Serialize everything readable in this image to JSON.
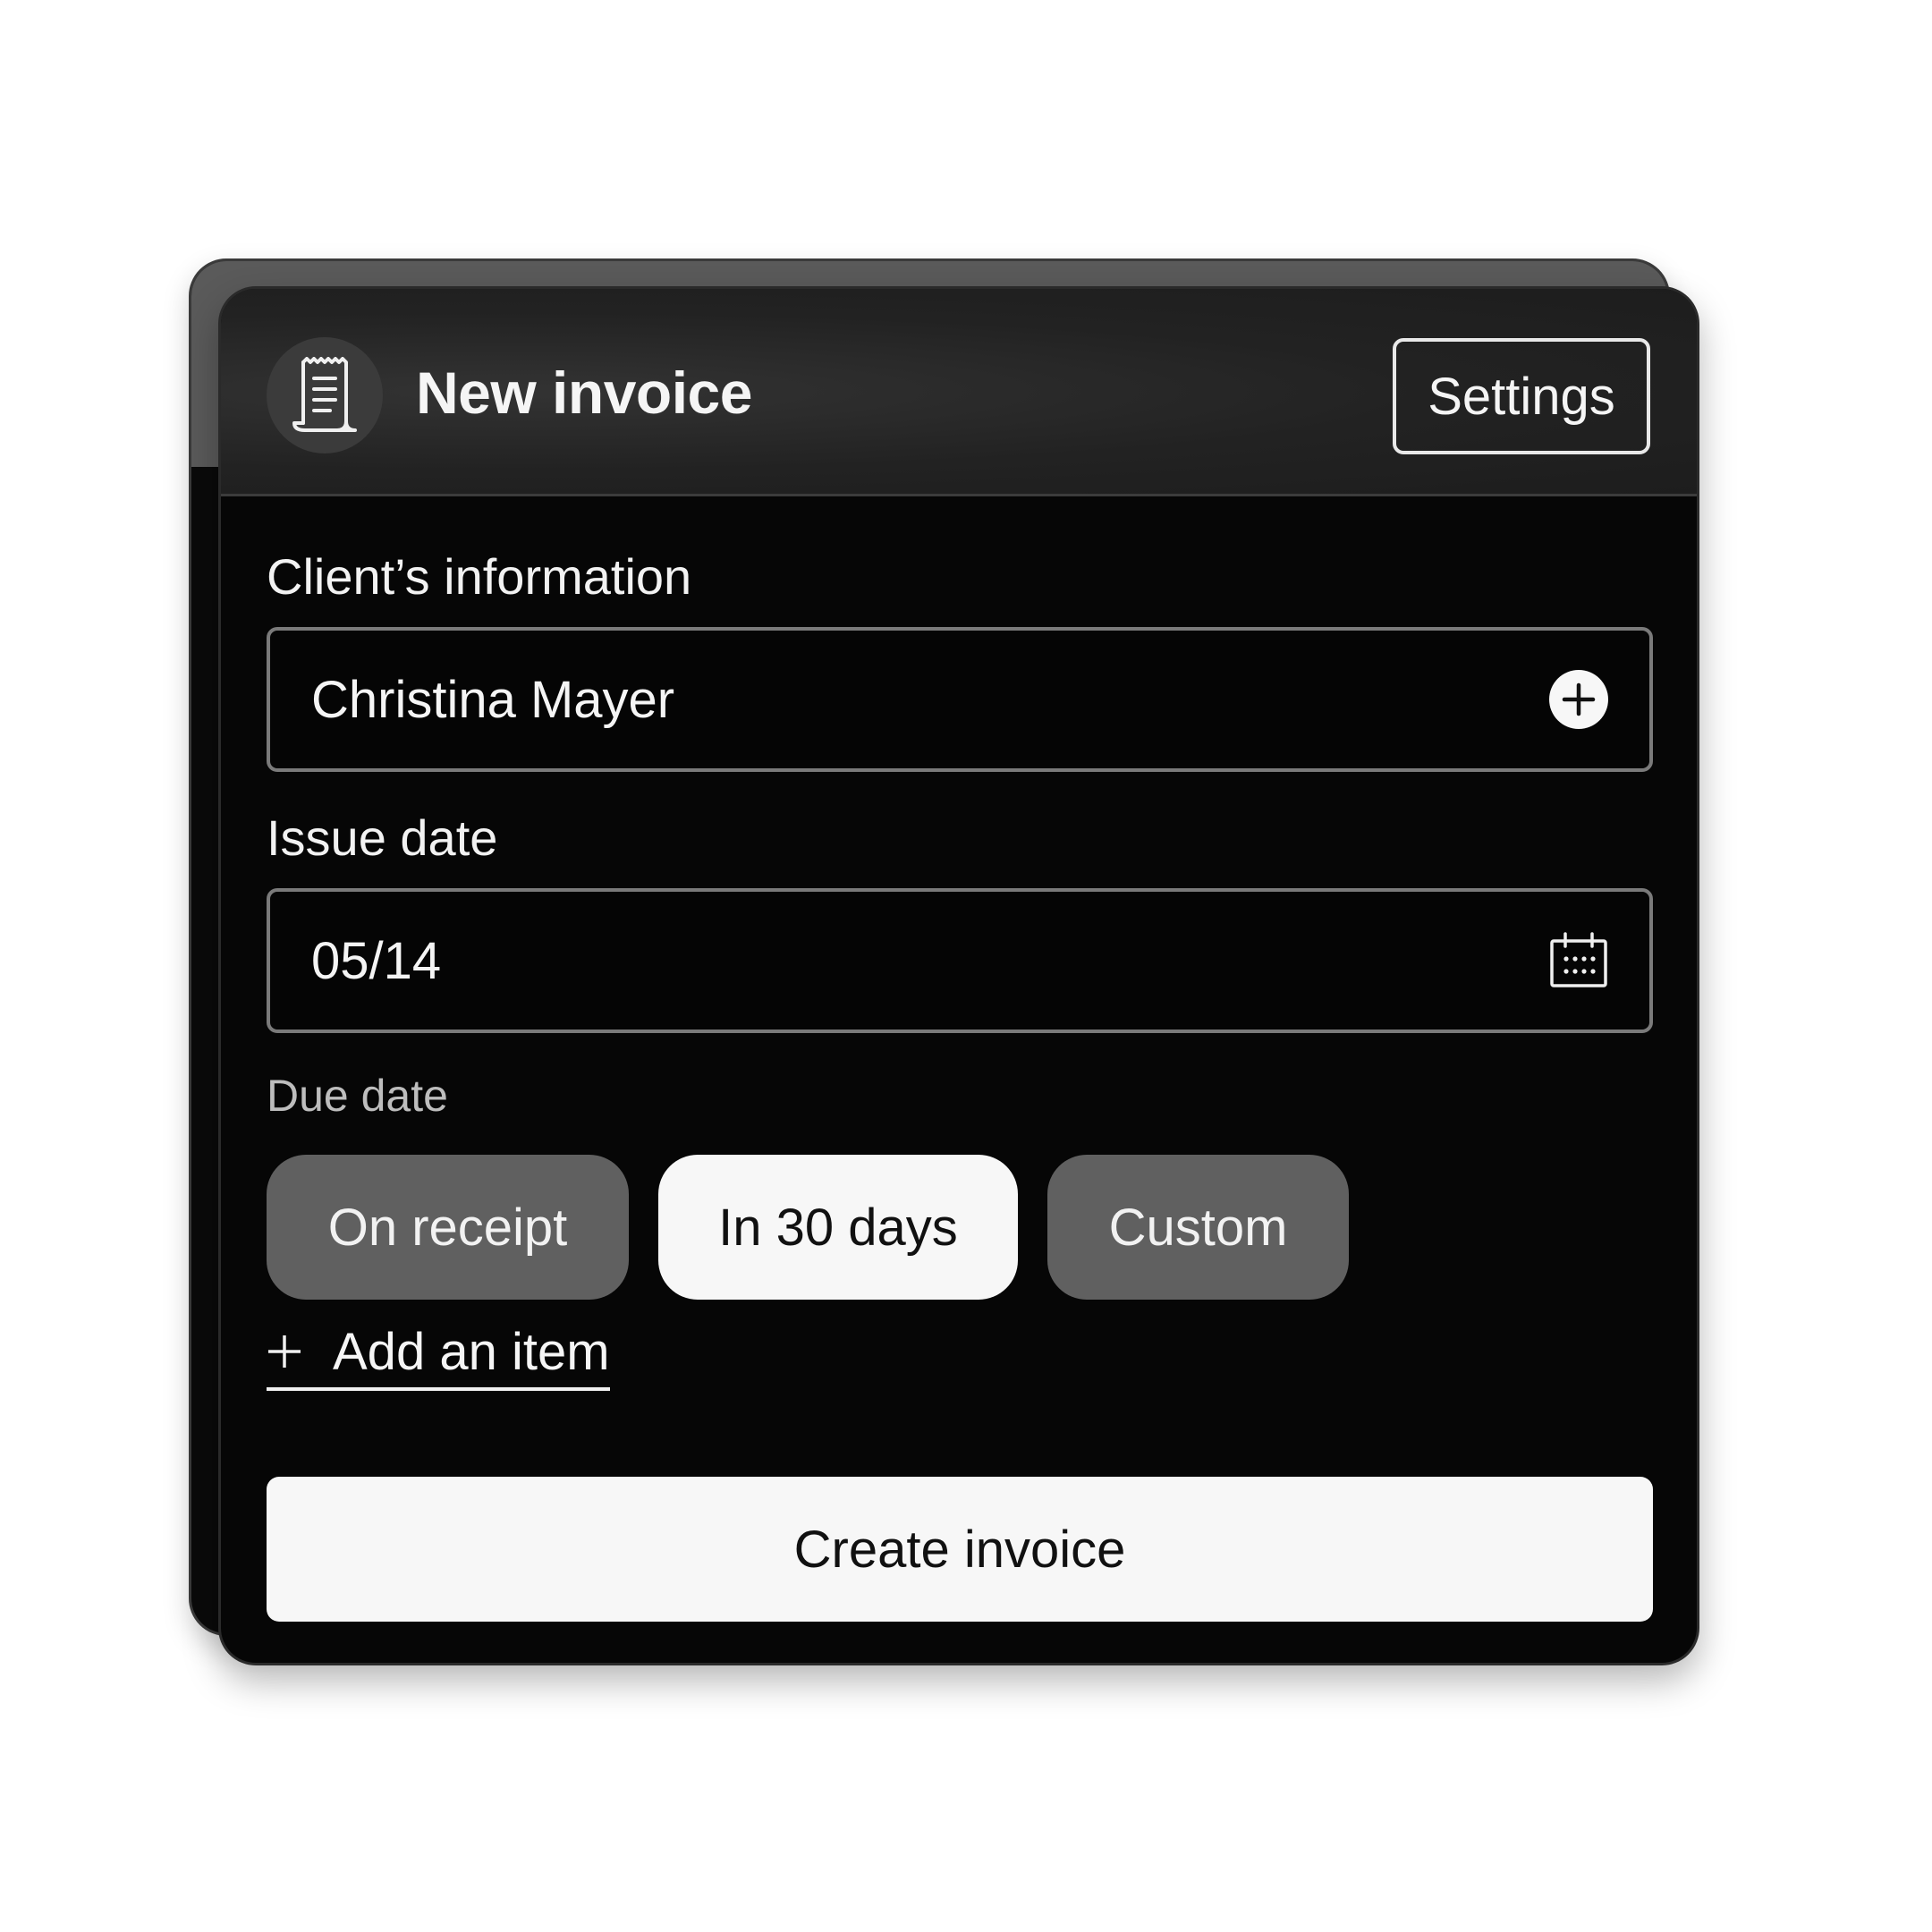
{
  "header": {
    "title": "New invoice",
    "icon": "receipt-icon",
    "settings_label": "Settings"
  },
  "client": {
    "label": "Client’s information",
    "value": "Christina Mayer",
    "action_icon": "plus-circle-icon"
  },
  "issue_date": {
    "label": "Issue date",
    "value": "05/14",
    "icon": "calendar-icon"
  },
  "due_date": {
    "label": "Due date",
    "options": [
      {
        "label": "On receipt",
        "selected": false
      },
      {
        "label": "In 30 days",
        "selected": true
      },
      {
        "label": "Custom",
        "selected": false
      }
    ]
  },
  "add_item": {
    "label": "Add an item",
    "icon": "plus-icon"
  },
  "create_button": {
    "label": "Create invoice"
  },
  "colors": {
    "card_background": "#060606",
    "header_background": "#222222",
    "chip_inactive": "#606060",
    "chip_active": "#f7f7f7",
    "primary_button": "#f7f7f7"
  }
}
